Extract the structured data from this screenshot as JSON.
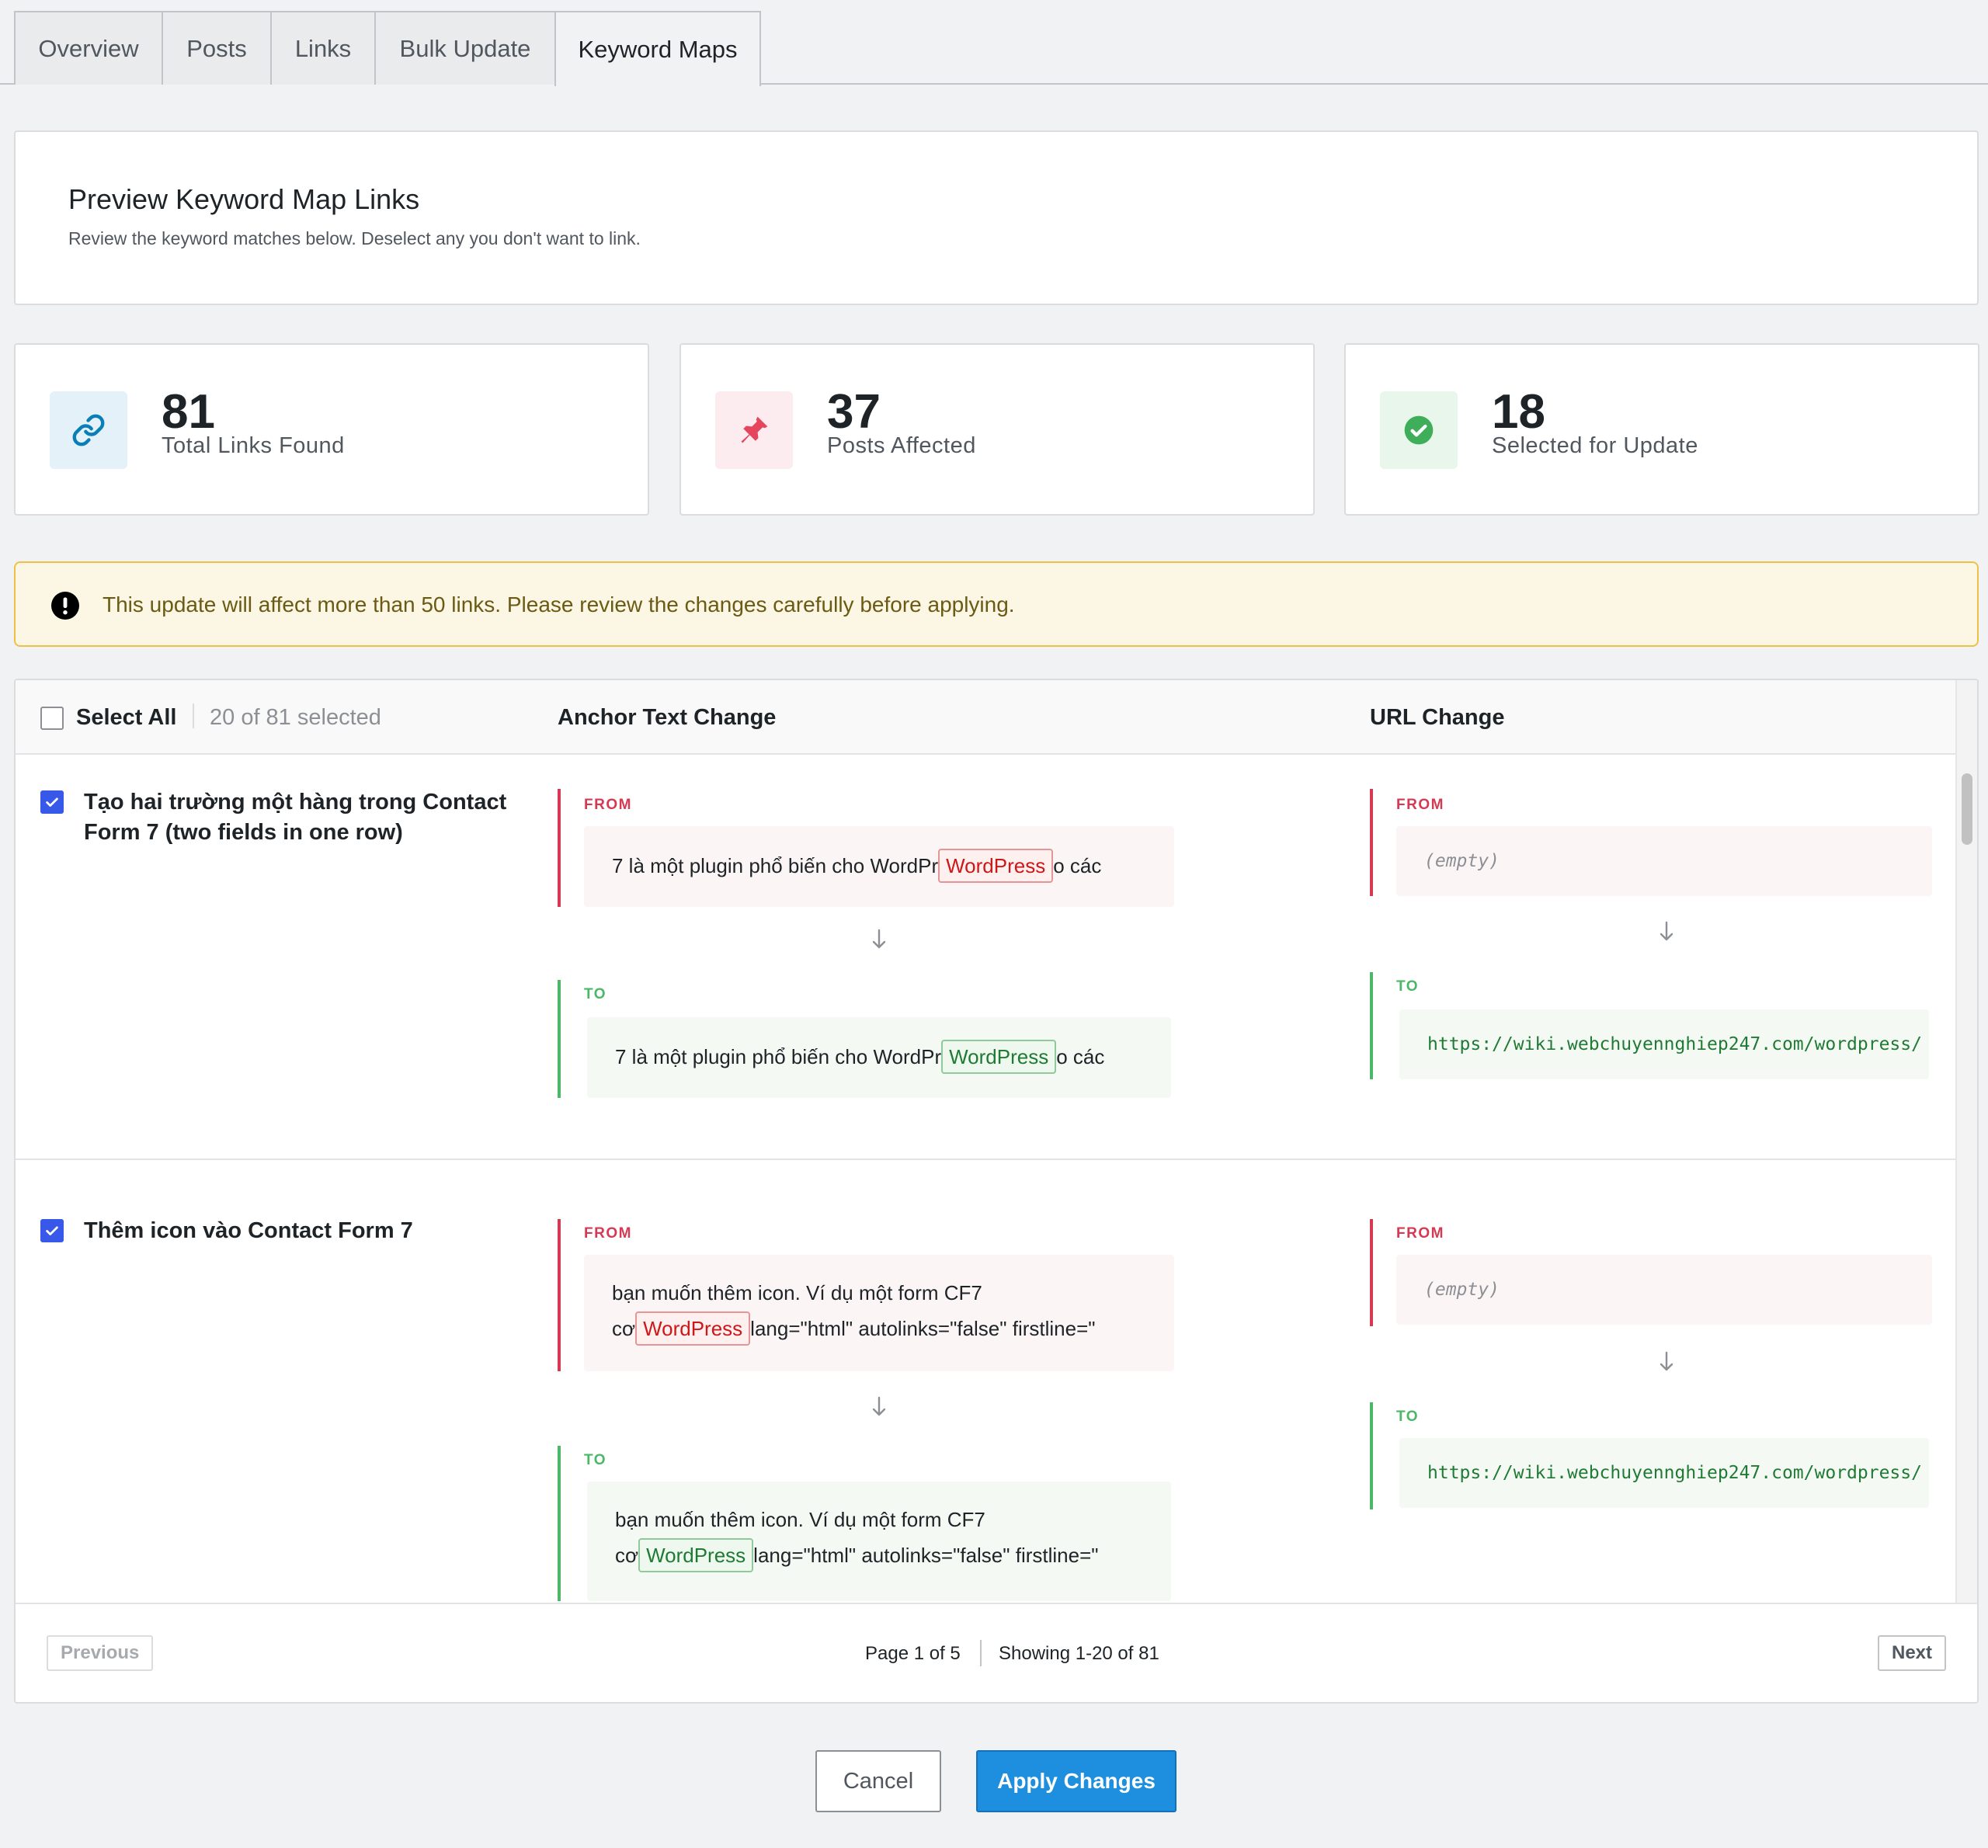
{
  "tabs": [
    {
      "label": "Overview",
      "active": false
    },
    {
      "label": "Posts",
      "active": false
    },
    {
      "label": "Links",
      "active": false
    },
    {
      "label": "Bulk Update",
      "active": false
    },
    {
      "label": "Keyword Maps",
      "active": true
    }
  ],
  "preview": {
    "title": "Preview Keyword Map Links",
    "subtitle": "Review the keyword matches below. Deselect any you don't want to link."
  },
  "stats": [
    {
      "value": "81",
      "label": "Total Links Found",
      "icon": "link-icon",
      "color": "#0a7fb5",
      "bg": "#e4f1f9"
    },
    {
      "value": "37",
      "label": "Posts Affected",
      "icon": "pushpin-icon",
      "color": "#e6455e",
      "bg": "#fdecef"
    },
    {
      "value": "18",
      "label": "Selected for Update",
      "icon": "check-circle-icon",
      "color": "#3fae5a",
      "bg": "#e9f6ec"
    }
  ],
  "warning": {
    "icon": "exclamation-circle-icon",
    "text": "This update will affect more than 50 links. Please review the changes carefully before applying."
  },
  "table": {
    "select_all_label": "Select All",
    "selected_count": "20 of 81 selected",
    "col_anchor": "Anchor Text Change",
    "col_url": "URL Change",
    "from_label": "FROM",
    "to_label": "TO",
    "rows": [
      {
        "checked": true,
        "title": "Tạo hai trường một hàng trong Contact Form 7 (two fields in one row)",
        "anchor_from": {
          "before": "7 là một plugin phổ biến cho WordPr",
          "keyword": "WordPress",
          "after": "o các"
        },
        "anchor_to": {
          "before": "7 là một plugin phổ biến cho WordPr",
          "keyword": "WordPress",
          "after": "o các"
        },
        "url_from": "(empty)",
        "url_to": "https://wiki.webchuyennghiep247.com/wordpress/"
      },
      {
        "checked": true,
        "title": "Thêm icon vào Contact Form 7",
        "anchor_from": {
          "line1": "bạn muốn thêm icon. Ví dụ một form CF7",
          "before": "cơ",
          "keyword": "WordPress",
          "after": "lang=\"html\" autolinks=\"false\" firstline=\""
        },
        "anchor_to": {
          "line1": "bạn muốn thêm icon. Ví dụ một form CF7",
          "before": "cơ",
          "keyword": "WordPress",
          "after": "lang=\"html\" autolinks=\"false\" firstline=\""
        },
        "url_from": "(empty)",
        "url_to": "https://wiki.webchuyennghiep247.com/wordpress/"
      }
    ]
  },
  "pagination": {
    "previous": "Previous",
    "next": "Next",
    "page": "Page 1 of 5",
    "showing": "Showing 1-20 of 81"
  },
  "actions": {
    "cancel": "Cancel",
    "apply": "Apply Changes"
  },
  "colors": {
    "accent": "#3858e9",
    "primary_button": "#1e8fde",
    "from": "#d63a52",
    "to": "#4ab866",
    "warning_bg": "#fcf7e4",
    "warning_border": "#f0c046"
  }
}
